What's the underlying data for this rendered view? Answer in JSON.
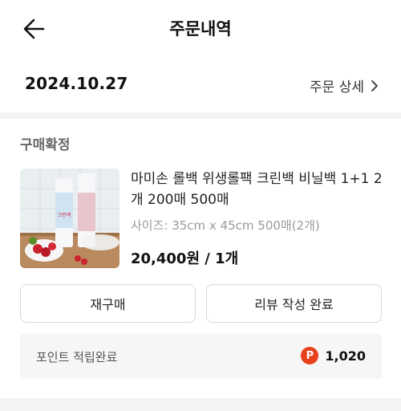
{
  "header": {
    "title": "주문내역",
    "back_icon": "arrow-left-icon"
  },
  "order": {
    "date": "2024.10.27",
    "detail_label": "주문 상세",
    "detail_icon": "chevron-right-icon"
  },
  "status": "구매확정",
  "product": {
    "name": "마미손 롤백 위생롤팩 크린백 비닐백 1+1 2개 200매 500매",
    "option": "사이즈: 35cm x 45cm 500매(2개)",
    "price": "20,400원 / 1개",
    "thumb_text": "크린백"
  },
  "buttons": {
    "rebuy": "재구매",
    "review": "리뷰 작성 완료"
  },
  "points": {
    "label": "포인트 적립완료",
    "badge": "P",
    "amount": "1,020",
    "badge_color": "#e8401c"
  }
}
